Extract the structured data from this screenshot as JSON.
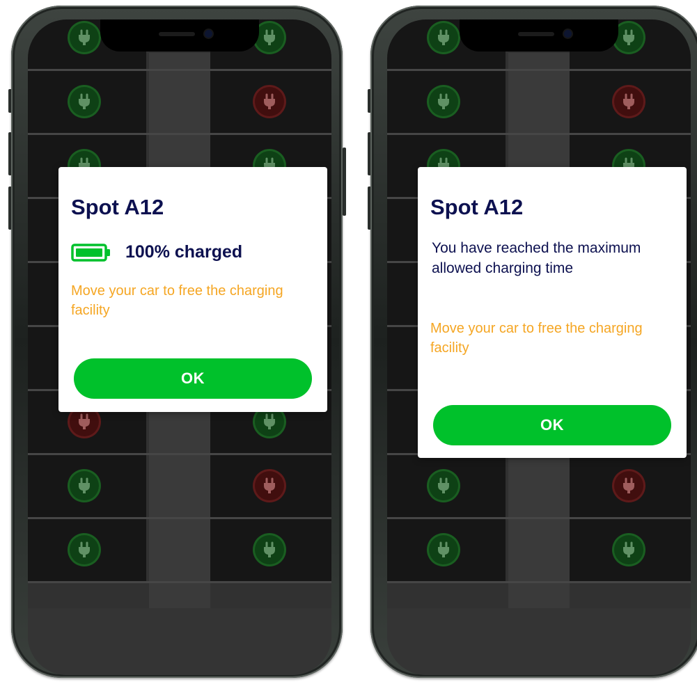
{
  "screens": [
    {
      "modal": {
        "title": "Spot A12",
        "status_text": "100% charged",
        "warning": "Move your car to free the charging facility",
        "ok_label": "OK",
        "battery_level": 1.0
      },
      "spots_left": [
        "green",
        "green",
        "green",
        "green",
        "green",
        "green",
        "red",
        "green",
        "green"
      ],
      "spots_right": [
        "green",
        "red",
        "green",
        "green",
        "green",
        "green",
        "green",
        "red",
        "green"
      ]
    },
    {
      "modal": {
        "title": "Spot A12",
        "message": "You have reached the maximum allowed charging time",
        "warning": "Move your car to free the charging facility",
        "ok_label": "OK"
      },
      "spots_left": [
        "green",
        "green",
        "green",
        "green",
        "green",
        "green",
        "red",
        "green",
        "green"
      ],
      "spots_right": [
        "green",
        "red",
        "green",
        "green",
        "green",
        "green",
        "green",
        "red",
        "green"
      ]
    }
  ],
  "colors": {
    "title": "#0d1150",
    "warning": "#f5a623",
    "ok_button": "#00c12b",
    "plug_available": "#1e6b26",
    "plug_occupied": "#6b1e1e"
  },
  "icons": [
    "plug-icon",
    "battery-full-icon"
  ]
}
